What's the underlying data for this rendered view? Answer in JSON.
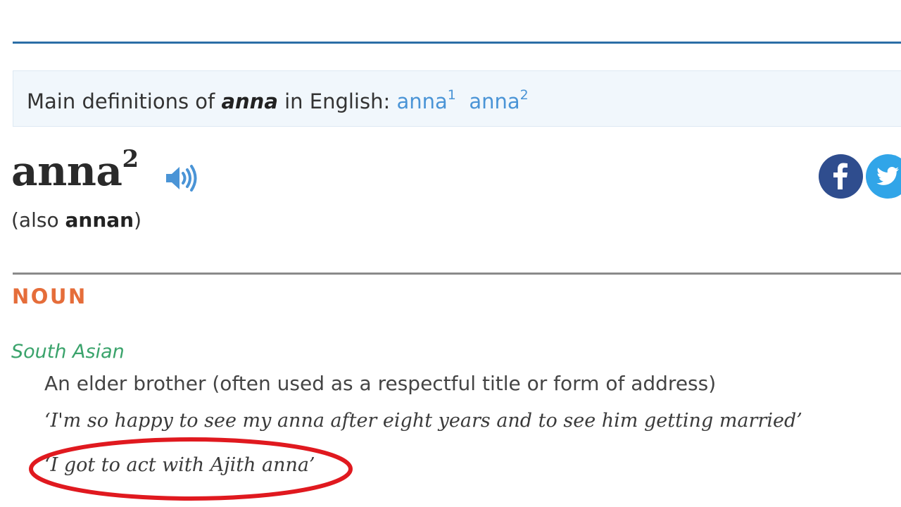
{
  "definitions_box": {
    "prefix": "Main definitions of ",
    "headword": "anna",
    "suffix": " in English: ",
    "links": [
      {
        "label": "anna",
        "sup": "1"
      },
      {
        "label": "anna",
        "sup": "2"
      }
    ]
  },
  "entry": {
    "headword": "anna",
    "homograph": "2",
    "audio_icon": "speaker-icon",
    "variant_prefix": "(also ",
    "variant": "annan",
    "variant_suffix": ")"
  },
  "share": {
    "facebook_icon": "facebook-icon",
    "twitter_icon": "twitter-icon"
  },
  "sense": {
    "part_of_speech": "NOUN",
    "region": "South Asian",
    "definition": "An elder brother (often used as a respectful title or form of address)",
    "examples": [
      "‘I'm so happy to see my anna after eight years and to see him getting married’",
      "‘I got to act with Ajith anna’"
    ]
  },
  "colors": {
    "link": "#4a94d6",
    "top_rule": "#2b6ea6",
    "part_of_speech": "#e56d3a",
    "region": "#3aa36b",
    "highlight": "#e0191f",
    "facebook": "#2f4d8e",
    "twitter": "#31a5e8"
  }
}
